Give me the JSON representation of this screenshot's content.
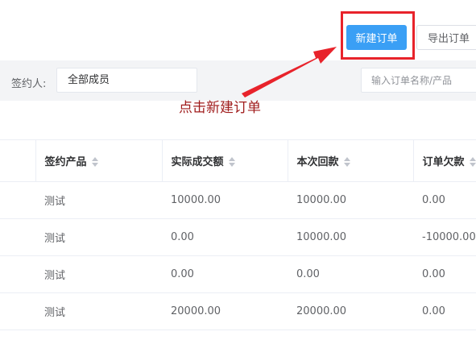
{
  "toolbar": {
    "new_order_label": "新建订单",
    "export_label": "导出订单"
  },
  "filters": {
    "signer_label": "签约人:",
    "signer_value": "全部成员",
    "search_placeholder": "输入订单名称/产品"
  },
  "annotation": {
    "text": "点击新建订单",
    "color": "#a01d1d",
    "highlight_color": "#e8232b"
  },
  "table": {
    "columns": [
      "签约产品",
      "实际成交额",
      "本次回款",
      "订单欠款"
    ],
    "rows": [
      [
        "测试",
        "10000.00",
        "10000.00",
        "0.00"
      ],
      [
        "测试",
        "0.00",
        "10000.00",
        "-10000.00"
      ],
      [
        "测试",
        "0.00",
        "0.00",
        "0.00"
      ],
      [
        "测试",
        "20000.00",
        "20000.00",
        "0.00"
      ]
    ]
  },
  "colors": {
    "primary": "#3a9ff5",
    "filter_bar_bg": "#f3f4f6"
  }
}
